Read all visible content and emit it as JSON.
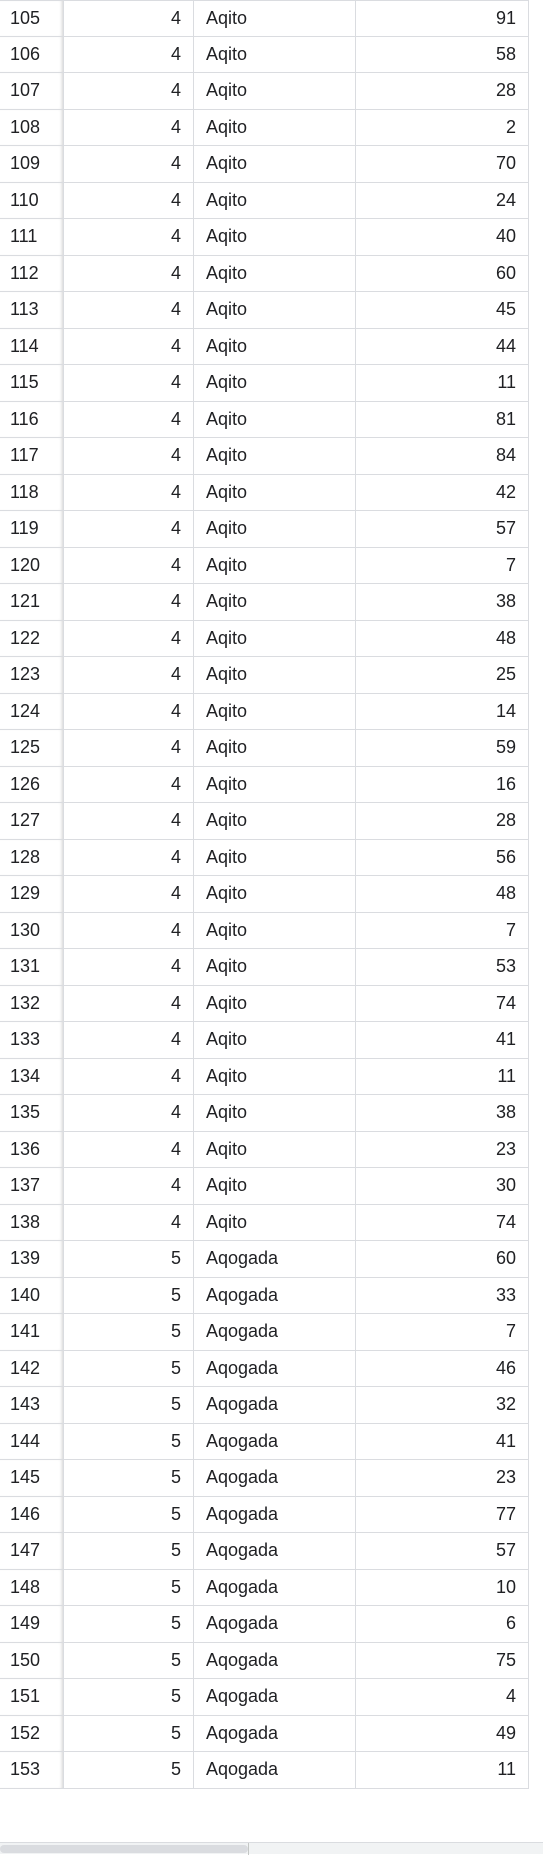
{
  "rows": [
    {
      "id": "105",
      "group": "4",
      "name": "Aqito",
      "value": "91"
    },
    {
      "id": "106",
      "group": "4",
      "name": "Aqito",
      "value": "58"
    },
    {
      "id": "107",
      "group": "4",
      "name": "Aqito",
      "value": "28"
    },
    {
      "id": "108",
      "group": "4",
      "name": "Aqito",
      "value": "2"
    },
    {
      "id": "109",
      "group": "4",
      "name": "Aqito",
      "value": "70"
    },
    {
      "id": "110",
      "group": "4",
      "name": "Aqito",
      "value": "24"
    },
    {
      "id": "111",
      "group": "4",
      "name": "Aqito",
      "value": "40"
    },
    {
      "id": "112",
      "group": "4",
      "name": "Aqito",
      "value": "60"
    },
    {
      "id": "113",
      "group": "4",
      "name": "Aqito",
      "value": "45"
    },
    {
      "id": "114",
      "group": "4",
      "name": "Aqito",
      "value": "44"
    },
    {
      "id": "115",
      "group": "4",
      "name": "Aqito",
      "value": "11"
    },
    {
      "id": "116",
      "group": "4",
      "name": "Aqito",
      "value": "81"
    },
    {
      "id": "117",
      "group": "4",
      "name": "Aqito",
      "value": "84"
    },
    {
      "id": "118",
      "group": "4",
      "name": "Aqito",
      "value": "42"
    },
    {
      "id": "119",
      "group": "4",
      "name": "Aqito",
      "value": "57"
    },
    {
      "id": "120",
      "group": "4",
      "name": "Aqito",
      "value": "7"
    },
    {
      "id": "121",
      "group": "4",
      "name": "Aqito",
      "value": "38"
    },
    {
      "id": "122",
      "group": "4",
      "name": "Aqito",
      "value": "48"
    },
    {
      "id": "123",
      "group": "4",
      "name": "Aqito",
      "value": "25"
    },
    {
      "id": "124",
      "group": "4",
      "name": "Aqito",
      "value": "14"
    },
    {
      "id": "125",
      "group": "4",
      "name": "Aqito",
      "value": "59"
    },
    {
      "id": "126",
      "group": "4",
      "name": "Aqito",
      "value": "16"
    },
    {
      "id": "127",
      "group": "4",
      "name": "Aqito",
      "value": "28"
    },
    {
      "id": "128",
      "group": "4",
      "name": "Aqito",
      "value": "56"
    },
    {
      "id": "129",
      "group": "4",
      "name": "Aqito",
      "value": "48"
    },
    {
      "id": "130",
      "group": "4",
      "name": "Aqito",
      "value": "7"
    },
    {
      "id": "131",
      "group": "4",
      "name": "Aqito",
      "value": "53"
    },
    {
      "id": "132",
      "group": "4",
      "name": "Aqito",
      "value": "74"
    },
    {
      "id": "133",
      "group": "4",
      "name": "Aqito",
      "value": "41"
    },
    {
      "id": "134",
      "group": "4",
      "name": "Aqito",
      "value": "11"
    },
    {
      "id": "135",
      "group": "4",
      "name": "Aqito",
      "value": "38"
    },
    {
      "id": "136",
      "group": "4",
      "name": "Aqito",
      "value": "23"
    },
    {
      "id": "137",
      "group": "4",
      "name": "Aqito",
      "value": "30"
    },
    {
      "id": "138",
      "group": "4",
      "name": "Aqito",
      "value": "74"
    },
    {
      "id": "139",
      "group": "5",
      "name": "Aqogada",
      "value": "60"
    },
    {
      "id": "140",
      "group": "5",
      "name": "Aqogada",
      "value": "33"
    },
    {
      "id": "141",
      "group": "5",
      "name": "Aqogada",
      "value": "7"
    },
    {
      "id": "142",
      "group": "5",
      "name": "Aqogada",
      "value": "46"
    },
    {
      "id": "143",
      "group": "5",
      "name": "Aqogada",
      "value": "32"
    },
    {
      "id": "144",
      "group": "5",
      "name": "Aqogada",
      "value": "41"
    },
    {
      "id": "145",
      "group": "5",
      "name": "Aqogada",
      "value": "23"
    },
    {
      "id": "146",
      "group": "5",
      "name": "Aqogada",
      "value": "77"
    },
    {
      "id": "147",
      "group": "5",
      "name": "Aqogada",
      "value": "57"
    },
    {
      "id": "148",
      "group": "5",
      "name": "Aqogada",
      "value": "10"
    },
    {
      "id": "149",
      "group": "5",
      "name": "Aqogada",
      "value": "6"
    },
    {
      "id": "150",
      "group": "5",
      "name": "Aqogada",
      "value": "75"
    },
    {
      "id": "151",
      "group": "5",
      "name": "Aqogada",
      "value": "4"
    },
    {
      "id": "152",
      "group": "5",
      "name": "Aqogada",
      "value": "49"
    },
    {
      "id": "153",
      "group": "5",
      "name": "Aqogada",
      "value": "11"
    }
  ]
}
